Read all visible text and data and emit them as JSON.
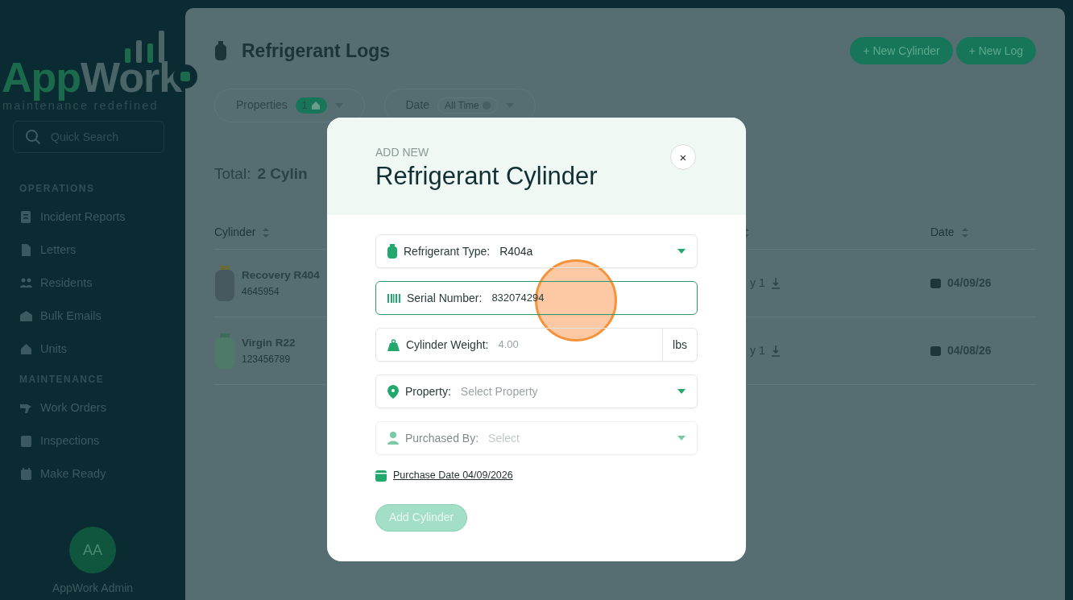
{
  "sidebar": {
    "logo": {
      "part_1": "App",
      "part_2": "Work",
      "tagline": "maintenance redefined"
    },
    "search": {
      "placeholder": "Quick Search"
    },
    "sections": [
      {
        "title": "OPERATIONS",
        "items": [
          {
            "label": "Incident Reports"
          },
          {
            "label": "Letters"
          },
          {
            "label": "Residents"
          },
          {
            "label": "Bulk Emails"
          },
          {
            "label": "Units"
          }
        ]
      },
      {
        "title": "MAINTENANCE",
        "items": [
          {
            "label": "Work Orders"
          },
          {
            "label": "Inspections"
          },
          {
            "label": "Make Ready"
          }
        ]
      }
    ],
    "user": {
      "initials": "AA",
      "name": "AppWork Admin"
    }
  },
  "page": {
    "title": "Refrigerant Logs",
    "buttons": [
      "+ New Cylinder",
      "+ New Log"
    ],
    "filters": [
      {
        "label": "Properties",
        "badge": "1"
      },
      {
        "label": "Date",
        "badge": "All Time"
      }
    ],
    "total": {
      "label": "Total:",
      "value": "2 Cylin"
    },
    "table": {
      "columns": [
        "Cylinder",
        "Date"
      ],
      "rows": [
        {
          "name": "Recovery R404",
          "serial": "4645954",
          "column_2": "y 1",
          "date": "04/09/26"
        },
        {
          "name": "Virgin R22",
          "serial": "123456789",
          "column_2": "y 1",
          "date": "04/08/26"
        }
      ]
    }
  },
  "modal": {
    "eyebrow": "ADD NEW",
    "title": "Refrigerant Cylinder",
    "close_label": "×",
    "fields": [
      {
        "kind": "select",
        "label": "Refrigerant Type:",
        "value": "R404a",
        "focused": false,
        "disabled": false
      },
      {
        "kind": "text",
        "label": "Serial Number:",
        "value": "832074294",
        "focused": true,
        "disabled": false
      },
      {
        "kind": "unit",
        "label": "Cylinder Weight:",
        "placeholder": "4.00",
        "unit": "lbs",
        "focused": false,
        "disabled": false
      },
      {
        "kind": "select",
        "label": "Property:",
        "placeholder": "Select Property",
        "focused": false,
        "disabled": false
      },
      {
        "kind": "select",
        "label": "Purchased By:",
        "placeholder": "Select",
        "focused": false,
        "disabled": true
      }
    ],
    "date_link": "Purchase Date 04/09/2026",
    "submit": {
      "label": "Add Cylinder",
      "disabled": true
    }
  }
}
